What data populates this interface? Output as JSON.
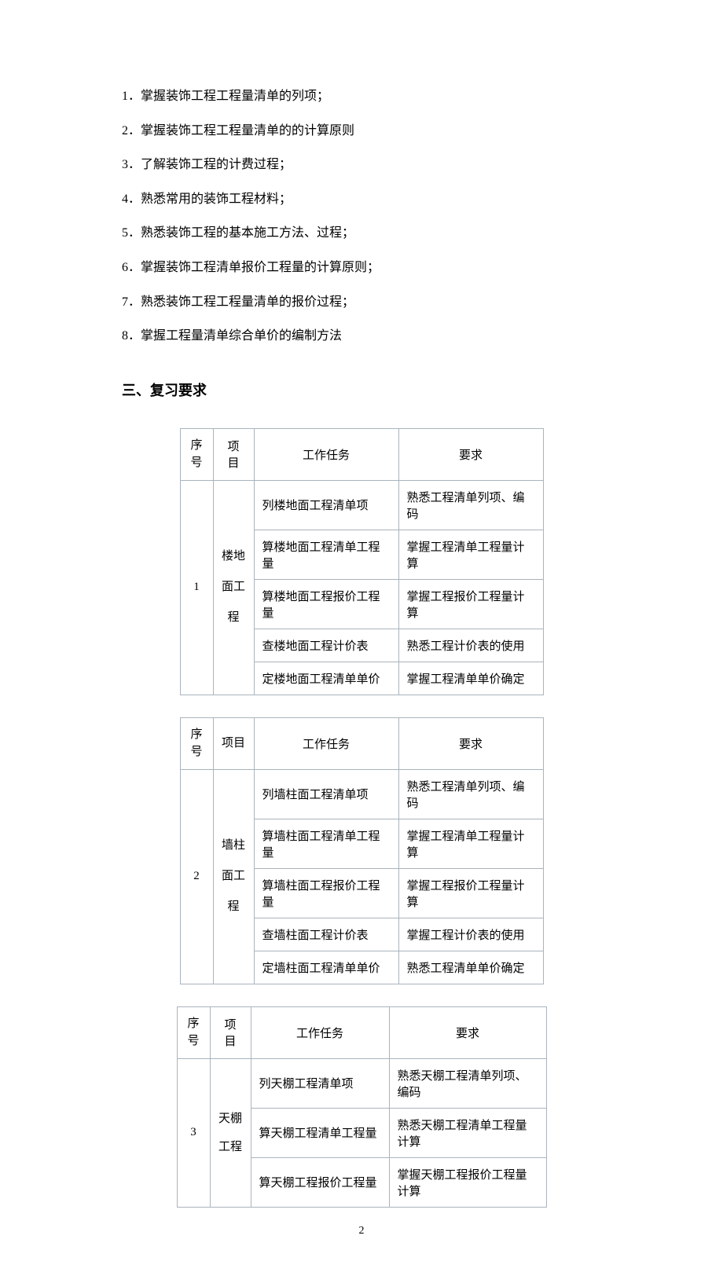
{
  "list": [
    "1．掌握装饰工程工程量清单的列项；",
    "2．掌握装饰工程工程量清单的的计算原则",
    "3．了解装饰工程的计费过程；",
    "4．熟悉常用的装饰工程材料；",
    "5．熟悉装饰工程的基本施工方法、过程；",
    "6．掌握装饰工程清单报价工程量的计算原则；",
    "7．熟悉装饰工程工程量清单的报价过程；",
    "8．掌握工程量清单综合单价的编制方法"
  ],
  "sectionHeading": "三、复习要求",
  "headers": {
    "seq": "序号",
    "proj": "项　目",
    "proj2": "项目",
    "task": "工作任务",
    "req": "要求"
  },
  "table1": {
    "seq": "1",
    "proj": "楼地面工程",
    "rows": [
      {
        "task": "列楼地面工程清单项",
        "req": "熟悉工程清单列项、编码"
      },
      {
        "task": "算楼地面工程清单工程量",
        "req": "掌握工程清单工程量计算"
      },
      {
        "task": "算楼地面工程报价工程量",
        "req": "掌握工程报价工程量计算"
      },
      {
        "task": "查楼地面工程计价表",
        "req": "熟悉工程计价表的使用"
      },
      {
        "task": "定楼地面工程清单单价",
        "req": "掌握工程清单单价确定"
      }
    ]
  },
  "table2": {
    "seq": "2",
    "proj": "墙柱面工程",
    "rows": [
      {
        "task": "列墙柱面工程清单项",
        "req": "熟悉工程清单列项、编码"
      },
      {
        "task": "算墙柱面工程清单工程量",
        "req": "掌握工程清单工程量计算"
      },
      {
        "task": "算墙柱面工程报价工程量",
        "req": "掌握工程报价工程量计算"
      },
      {
        "task": "查墙柱面工程计价表",
        "req": "掌握工程计价表的使用"
      },
      {
        "task": "定墙柱面工程清单单价",
        "req": "熟悉工程清单单价确定"
      }
    ]
  },
  "table3": {
    "seq": "3",
    "proj": "天棚工程",
    "rows": [
      {
        "task": "列天棚工程清单项",
        "req": "熟悉天棚工程清单列项、编码"
      },
      {
        "task": "算天棚工程清单工程量",
        "req": "熟悉天棚工程清单工程量计算"
      },
      {
        "task": "算天棚工程报价工程量",
        "req": "掌握天棚工程报价工程量计算"
      }
    ]
  },
  "pageNumber": "2"
}
